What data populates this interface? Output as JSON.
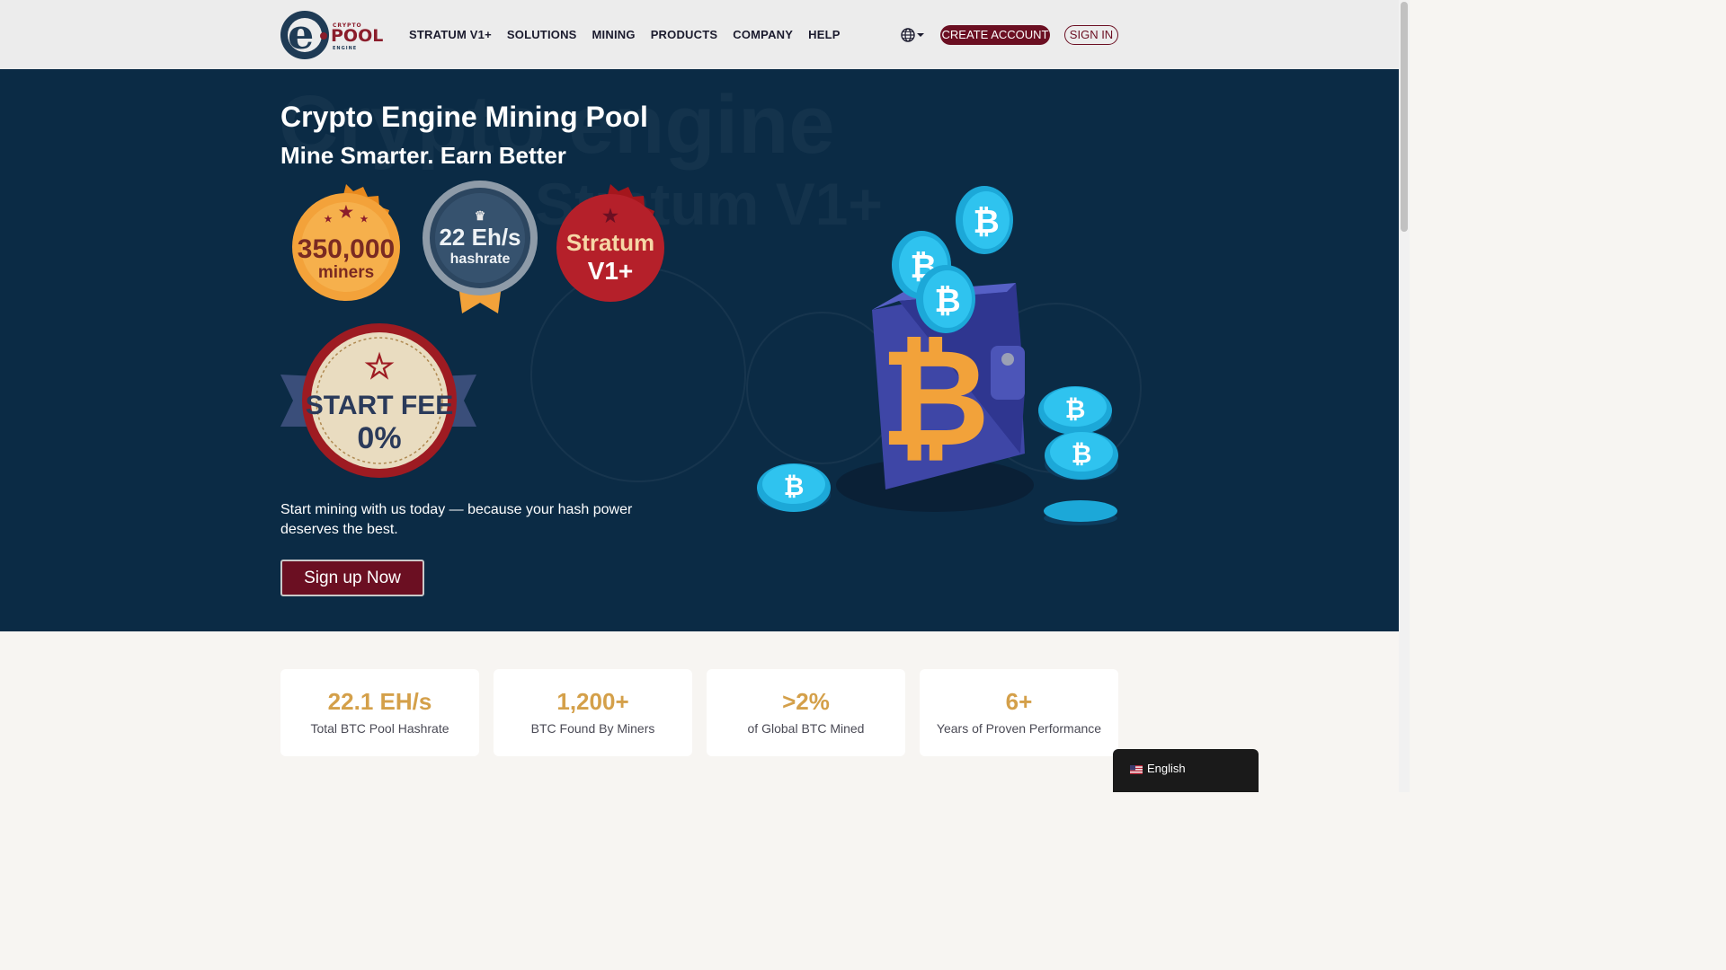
{
  "brand": {
    "crypto": "CRYPTO",
    "pool": "POOL",
    "engine": "ENGINE",
    "letter": "e"
  },
  "nav": {
    "items": [
      "STRATUM V1+",
      "SOLUTIONS",
      "MINING",
      "PRODUCTS",
      "COMPANY",
      "HELP"
    ],
    "create_account": "CREATE ACCOUNT",
    "sign_in": "SIGN IN",
    "language_icon": "globe-icon"
  },
  "hero": {
    "title": "Crypto Engine Mining Pool",
    "subtitle": "Mine Smarter. Earn Better",
    "background_text": "Crypto engine",
    "background_text_2": "Stratum V1+",
    "description": "Start mining with us today — because your hash power deserves the best.",
    "cta": "Sign up Now",
    "badges": {
      "miners": {
        "line1": "350,000",
        "line2": "miners"
      },
      "hashrate": {
        "line1": "22 Eh/s",
        "line2": "hashrate"
      },
      "stratum": {
        "line1": "Stratum",
        "line2": "V1+"
      },
      "fee": {
        "line1": "START FEE",
        "line2": "0%"
      }
    }
  },
  "stats": [
    {
      "value": "22.1 EH/s",
      "label": "Total BTC Pool Hashrate"
    },
    {
      "value": "1,200+",
      "label": "BTC Found By Miners"
    },
    {
      "value": ">2%",
      "label": "of Global BTC Mined"
    },
    {
      "value": "6+",
      "label": "Years of Proven Performance"
    }
  ],
  "language": {
    "label": "English",
    "flag_icon": "us-flag-icon"
  },
  "colors": {
    "header_bg": "#ececec",
    "hero_bg": "#0b2b45",
    "brand_red": "#6b0f22",
    "stat_gold": "#d4a04a",
    "page_bg": "#f7f5f2"
  }
}
